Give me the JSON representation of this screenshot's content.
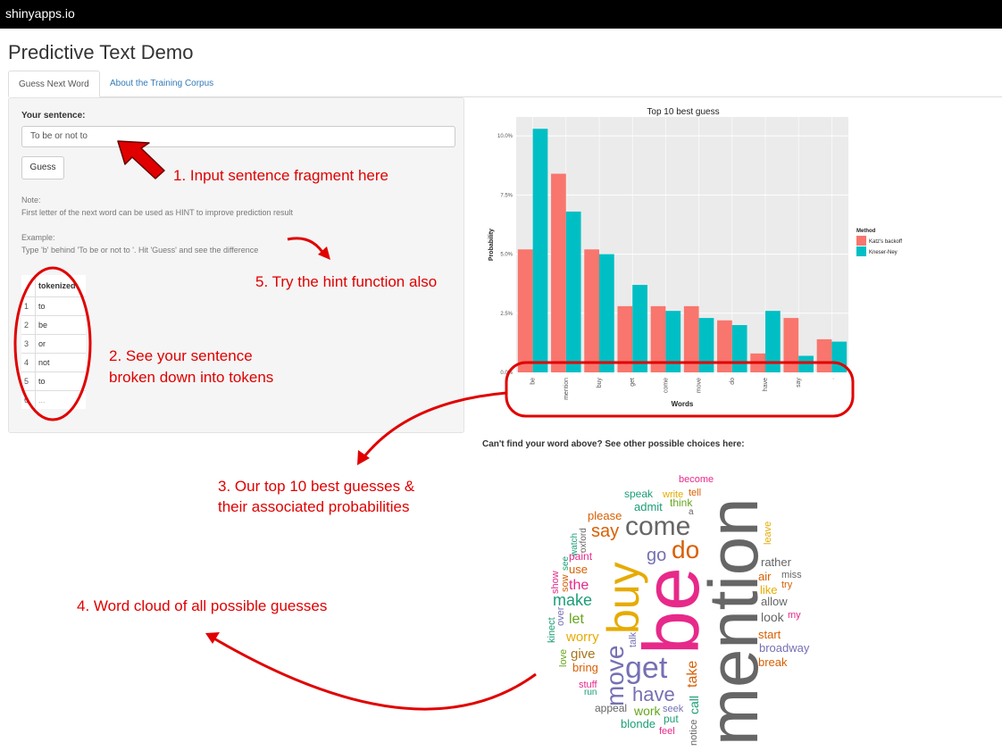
{
  "app": {
    "brand": "shinyapps.io",
    "title": "Predictive Text Demo"
  },
  "tabs": [
    {
      "label": "Guess Next Word",
      "active": true
    },
    {
      "label": "About the Training Corpus",
      "active": false
    }
  ],
  "sidebar": {
    "sentence_label": "Your sentence:",
    "sentence_value": "To be or not to",
    "guess_button": "Guess",
    "note_title": "Note:",
    "note_text": "First letter of the next word can be used as HINT to improve prediction result",
    "example_title": "Example:",
    "example_text": "Type 'b' behind 'To be or not to '. Hit 'Guess' and see the difference",
    "table": {
      "header": "tokenized",
      "rows": [
        {
          "idx": "1",
          "token": "to"
        },
        {
          "idx": "2",
          "token": "be"
        },
        {
          "idx": "3",
          "token": "or"
        },
        {
          "idx": "4",
          "token": "not"
        },
        {
          "idx": "5",
          "token": "to"
        },
        {
          "idx": "6",
          "token": "..."
        }
      ]
    }
  },
  "annotations": {
    "a1": "1. Input sentence fragment here",
    "a2_line1": "2. See your sentence",
    "a2_line2": "broken down into tokens",
    "a3_line1": "3. Our top 10 best guesses &",
    "a3_line2": "their associated probabilities",
    "a4": "4. Word cloud of all possible guesses",
    "a5": "5. Try the hint function also"
  },
  "colors": {
    "katz": "#f8766d",
    "kneser": "#00bfc4",
    "annotation": "#e00000",
    "link": "#337ab7"
  },
  "chart_data": {
    "type": "bar",
    "title": "Top 10 best guess",
    "xlabel": "Words",
    "ylabel": "Probability",
    "categories": [
      "be",
      "mention",
      "buy",
      "get",
      "come",
      "move",
      "do",
      "have",
      "say",
      "."
    ],
    "series": [
      {
        "name": "Katz's backoff",
        "values": [
          5.2,
          8.4,
          5.2,
          2.8,
          2.8,
          2.8,
          2.2,
          0.8,
          2.3,
          1.4
        ]
      },
      {
        "name": "Kneser-Ney",
        "values": [
          10.3,
          6.8,
          5.0,
          3.7,
          2.6,
          2.3,
          2.0,
          2.6,
          0.7,
          1.3
        ]
      }
    ],
    "legend_title": "Method",
    "yticks": [
      "0.0%",
      "2.5%",
      "5.0%",
      "7.5%",
      "10.0%"
    ],
    "ylim": [
      0,
      10.8
    ],
    "grid": true,
    "legend_position": "right"
  },
  "word_cloud": {
    "title": "Can't find your word above? See other possible choices here:",
    "words": [
      "mention",
      "be",
      "buy",
      "come",
      "get",
      "move",
      "have",
      "do",
      "say",
      "go",
      "make",
      "the",
      "let",
      "use",
      "paint",
      "worry",
      "give",
      "bring",
      "stuff",
      "run",
      "appeal",
      "work",
      "blonde",
      "feel",
      "put",
      "seek",
      "notice",
      "call",
      "take",
      "talk",
      "love",
      "kinect",
      "over",
      "show",
      "sow",
      "see",
      "watch",
      "oxford",
      "please",
      "admit",
      "speak",
      "write",
      "tell",
      "think",
      "a",
      "become",
      "leave",
      "rather",
      "miss",
      "air",
      "like",
      "try",
      "allow",
      "look",
      "my",
      "start",
      "broadway",
      "break"
    ]
  }
}
